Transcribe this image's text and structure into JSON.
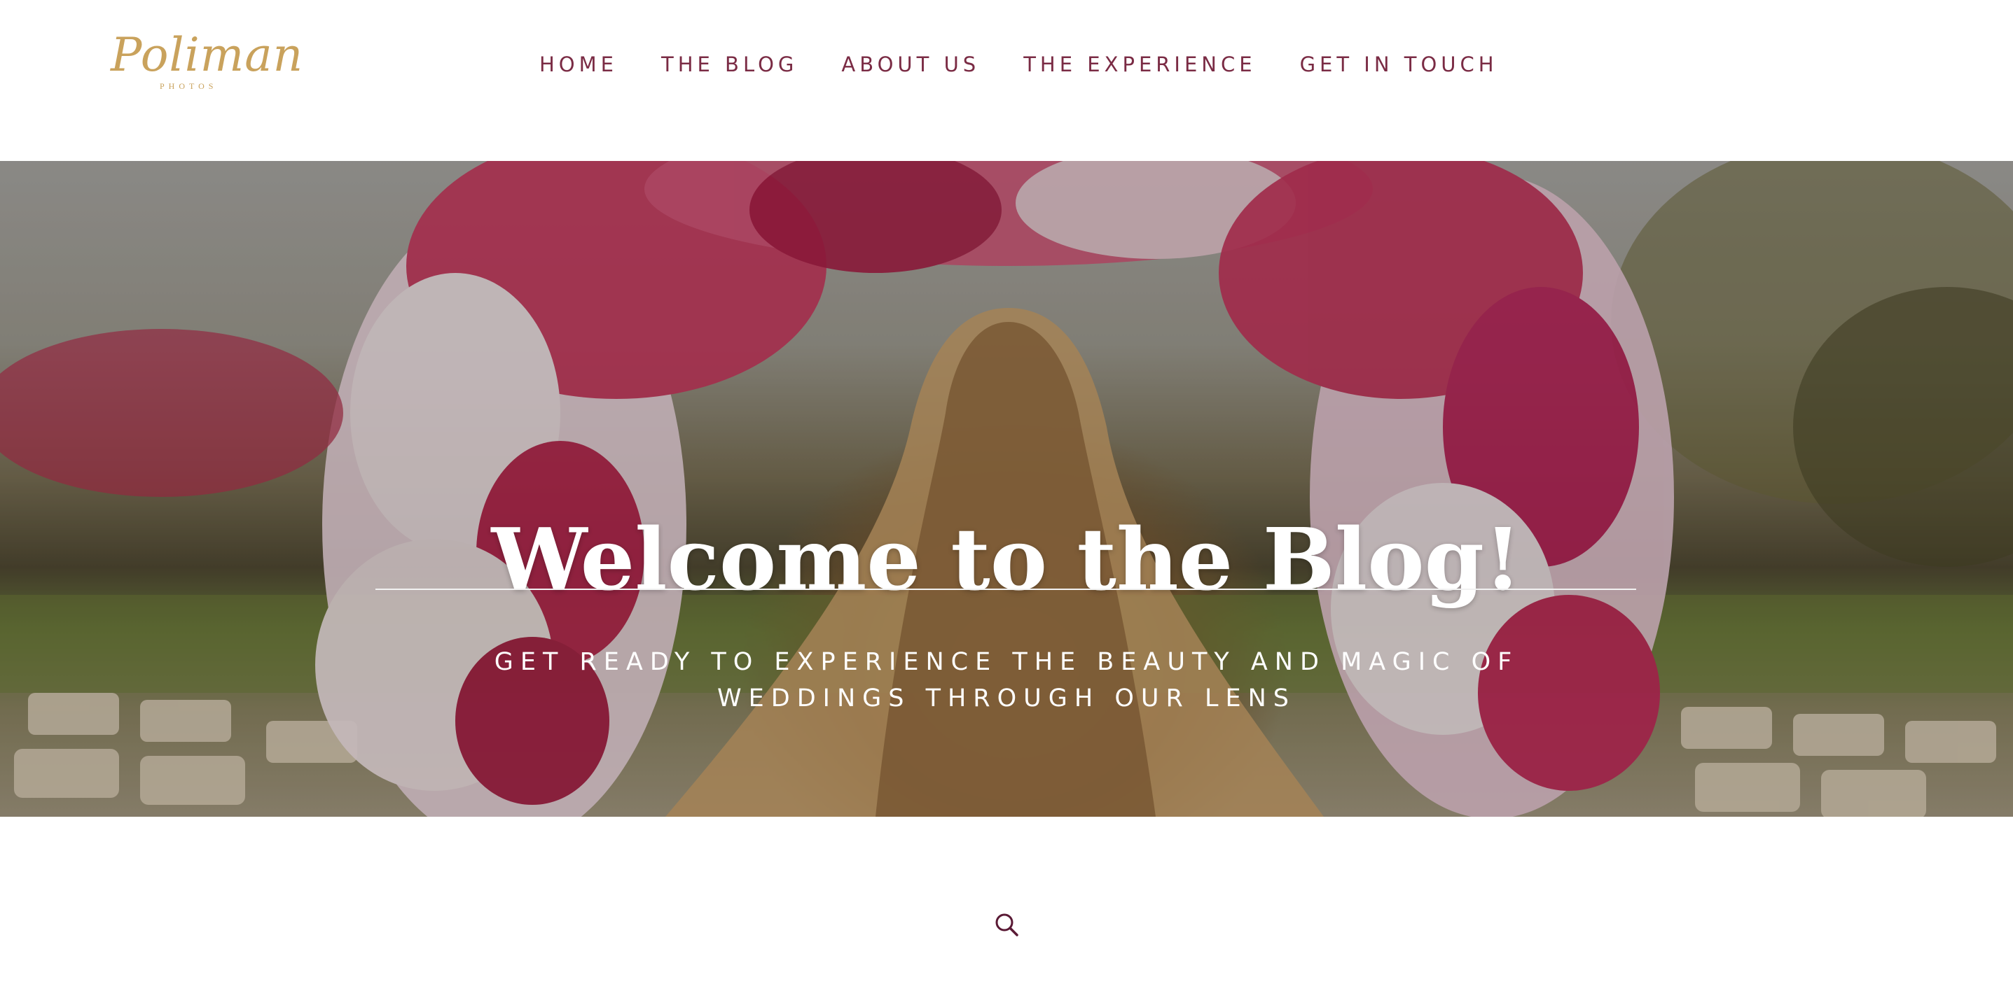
{
  "brand": {
    "logo_script": "Poliman",
    "logo_sub": "PHOTOS",
    "logo_color": "#c9a25c"
  },
  "nav": {
    "items": [
      {
        "label": "HOME"
      },
      {
        "label": "THE BLOG"
      },
      {
        "label": "ABOUT US"
      },
      {
        "label": "THE EXPERIENCE"
      },
      {
        "label": "GET IN TOUCH"
      }
    ],
    "color": "#7a2b44"
  },
  "hero": {
    "title": "Welcome to the Blog!",
    "subtitle": "GET READY TO EXPERIENCE THE BEAUTY AND MAGIC OF WEDDINGS THROUGH OUR LENS"
  },
  "search": {
    "icon": "search-icon",
    "color": "#5a1a35"
  }
}
